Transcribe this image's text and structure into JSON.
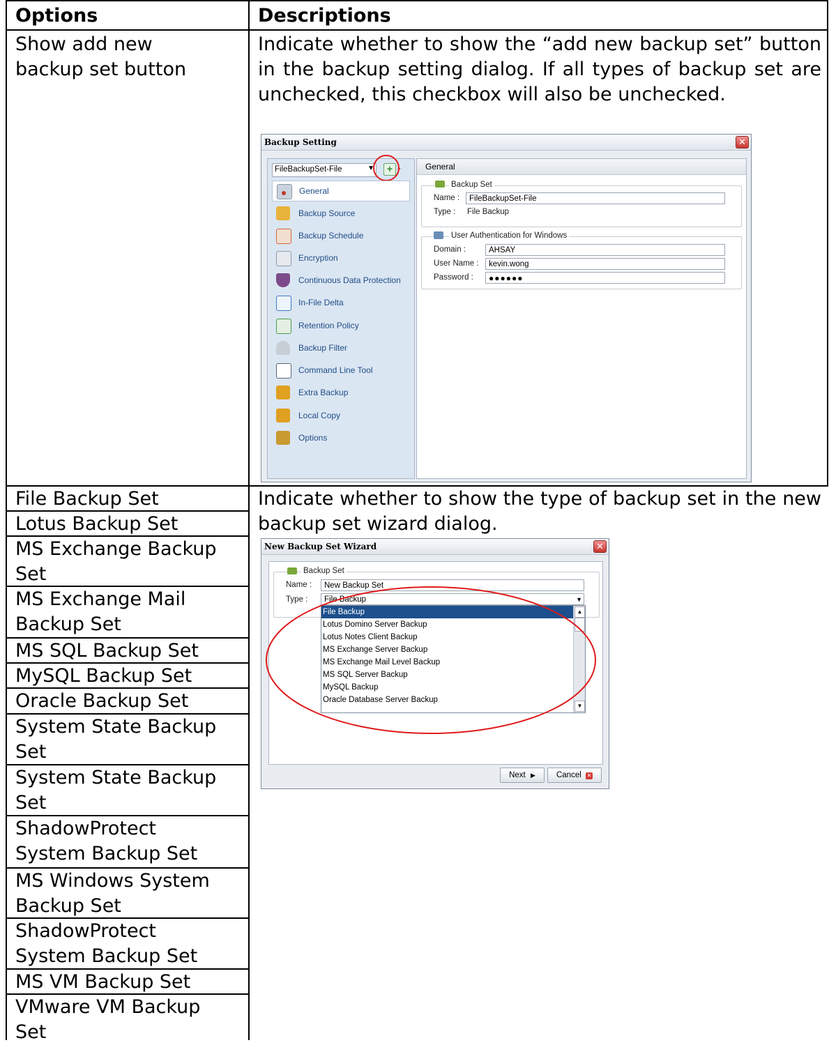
{
  "table": {
    "header_options": "Options",
    "header_descriptions": "Descriptions",
    "rows": [
      {
        "options": [
          "Show add new",
          "backup set button"
        ],
        "description": "Indicate whether to show the “add new backup set” button in the backup setting dialog. If all types of backup set are unchecked, this checkbox will also be unchecked."
      },
      {
        "description": "Indicate whether to show the type of backup set in the new backup set wizard dialog.",
        "options": [
          "File Backup Set",
          "Lotus Backup Set",
          "MS Exchange Backup Set",
          "MS Exchange Mail Backup Set",
          "MS SQL Backup Set",
          "MySQL Backup Set",
          "Oracle Backup Set",
          "System State Backup Set",
          "System State Backup Set",
          "ShadowProtect System Backup Set",
          "MS Windows System Backup Set",
          "ShadowProtect System Backup Set",
          "MS VM Backup Set",
          "VMware VM Backup Set"
        ]
      }
    ]
  },
  "backup_setting_dialog": {
    "title": "Backup Setting",
    "selector_value": "FileBackupSet-File",
    "sidebar": [
      {
        "label": "General",
        "icon": "general-icon",
        "color": "#c0392b"
      },
      {
        "label": "Backup Source",
        "icon": "folder-icon",
        "color": "#e8b33a"
      },
      {
        "label": "Backup Schedule",
        "icon": "schedule-icon",
        "color": "#d06a3a"
      },
      {
        "label": "Encryption",
        "icon": "encryption-icon",
        "color": "#8c98a8"
      },
      {
        "label": "Continuous Data Protection",
        "icon": "shield-icon",
        "color": "#7d4b8a"
      },
      {
        "label": "In-File Delta",
        "icon": "delta-icon",
        "color": "#3a78c4"
      },
      {
        "label": "Retention Policy",
        "icon": "recycle-icon",
        "color": "#4a9a4a"
      },
      {
        "label": "Backup Filter",
        "icon": "filter-icon",
        "color": "#9aa3ad"
      },
      {
        "label": "Command Line Tool",
        "icon": "terminal-icon",
        "color": "#5c6670"
      },
      {
        "label": "Extra Backup",
        "icon": "extra-backup-icon",
        "color": "#e0a020"
      },
      {
        "label": "Local Copy",
        "icon": "local-copy-icon",
        "color": "#e0a020"
      },
      {
        "label": "Options",
        "icon": "options-icon",
        "color": "#c89a30"
      }
    ],
    "panel_header": "General",
    "backup_set_group": "Backup Set",
    "name_label": "Name :",
    "name_value": "FileBackupSet-File",
    "type_label": "Type :",
    "type_value": "File Backup",
    "auth_group": "User Authentication for Windows",
    "domain_label": "Domain :",
    "domain_value": "AHSAY",
    "user_label": "User Name :",
    "user_value": "kevin.wong",
    "password_label": "Password :",
    "password_value": "●●●●●●"
  },
  "wizard_dialog": {
    "title": "New Backup Set Wizard",
    "group": "Backup Set",
    "name_label": "Name :",
    "name_value": "New Backup Set",
    "type_label": "Type :",
    "type_value": "File Backup",
    "options": [
      "File Backup",
      "Lotus Domino Server Backup",
      "Lotus Notes Client Backup",
      "MS Exchange Server Backup",
      "MS Exchange Mail Level Backup",
      "MS SQL Server Backup",
      "MySQL Backup",
      "Oracle Database Server Backup"
    ],
    "selected_option": "File Backup",
    "next_label": "Next",
    "cancel_label": "Cancel"
  },
  "colors": {
    "highlight": "#1c4f8c",
    "annotation_circle": "#e01b1b",
    "sidebar_bg": "#dbe6f3"
  }
}
